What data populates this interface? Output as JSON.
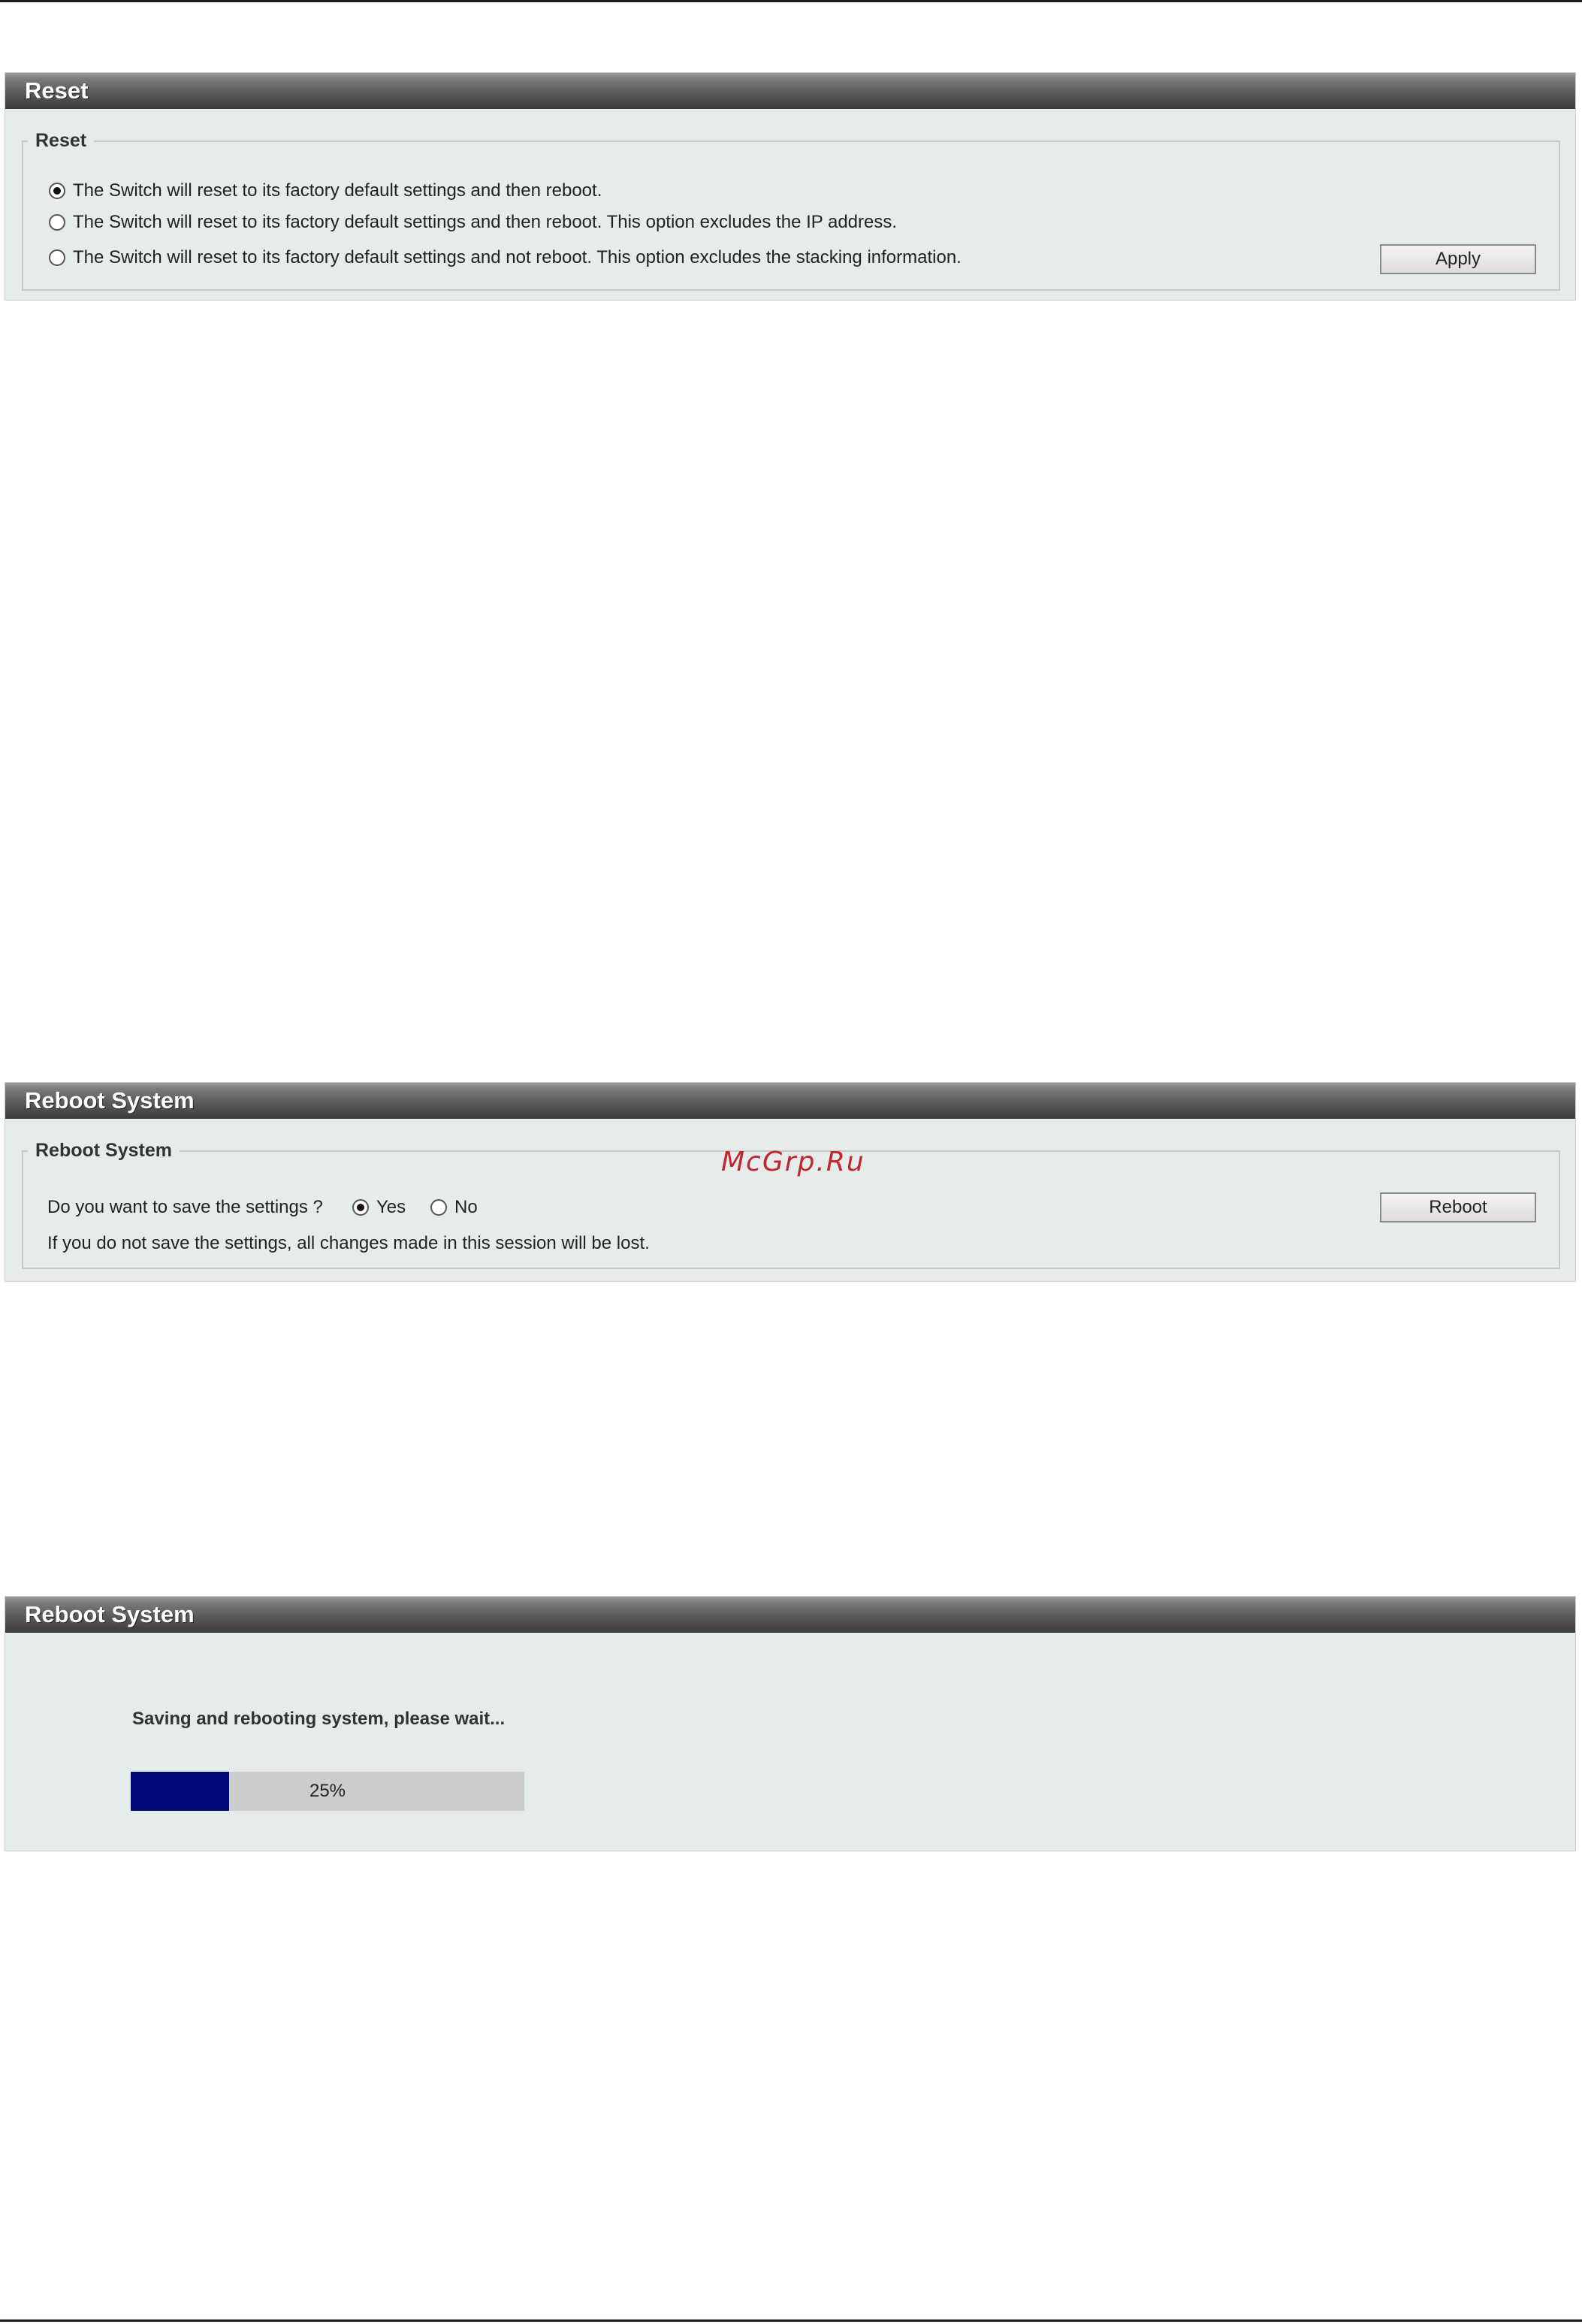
{
  "reset_panel": {
    "title": "Reset",
    "group_legend": "Reset",
    "options": [
      {
        "label": "The Switch will reset to its factory default settings and then reboot.",
        "checked": true
      },
      {
        "label": "The Switch will reset to its factory default settings and then reboot. This option excludes the IP address.",
        "checked": false
      },
      {
        "label": "The Switch will reset to its factory default settings and not reboot. This option excludes the stacking information.",
        "checked": false
      }
    ],
    "apply_label": "Apply"
  },
  "reboot_panel": {
    "title": "Reboot System",
    "group_legend": "Reboot System",
    "question": "Do you want to save the settings ?",
    "yes_label": "Yes",
    "no_label": "No",
    "selected": "Yes",
    "note": "If you do not save the settings, all changes made in this session will be lost.",
    "reboot_label": "Reboot"
  },
  "reboot_progress_panel": {
    "title": "Reboot System",
    "message": "Saving and rebooting system, please wait...",
    "progress_percent": 25,
    "progress_label": "25%",
    "fill_color": "#020a7a"
  },
  "watermark": "McGrp.Ru"
}
